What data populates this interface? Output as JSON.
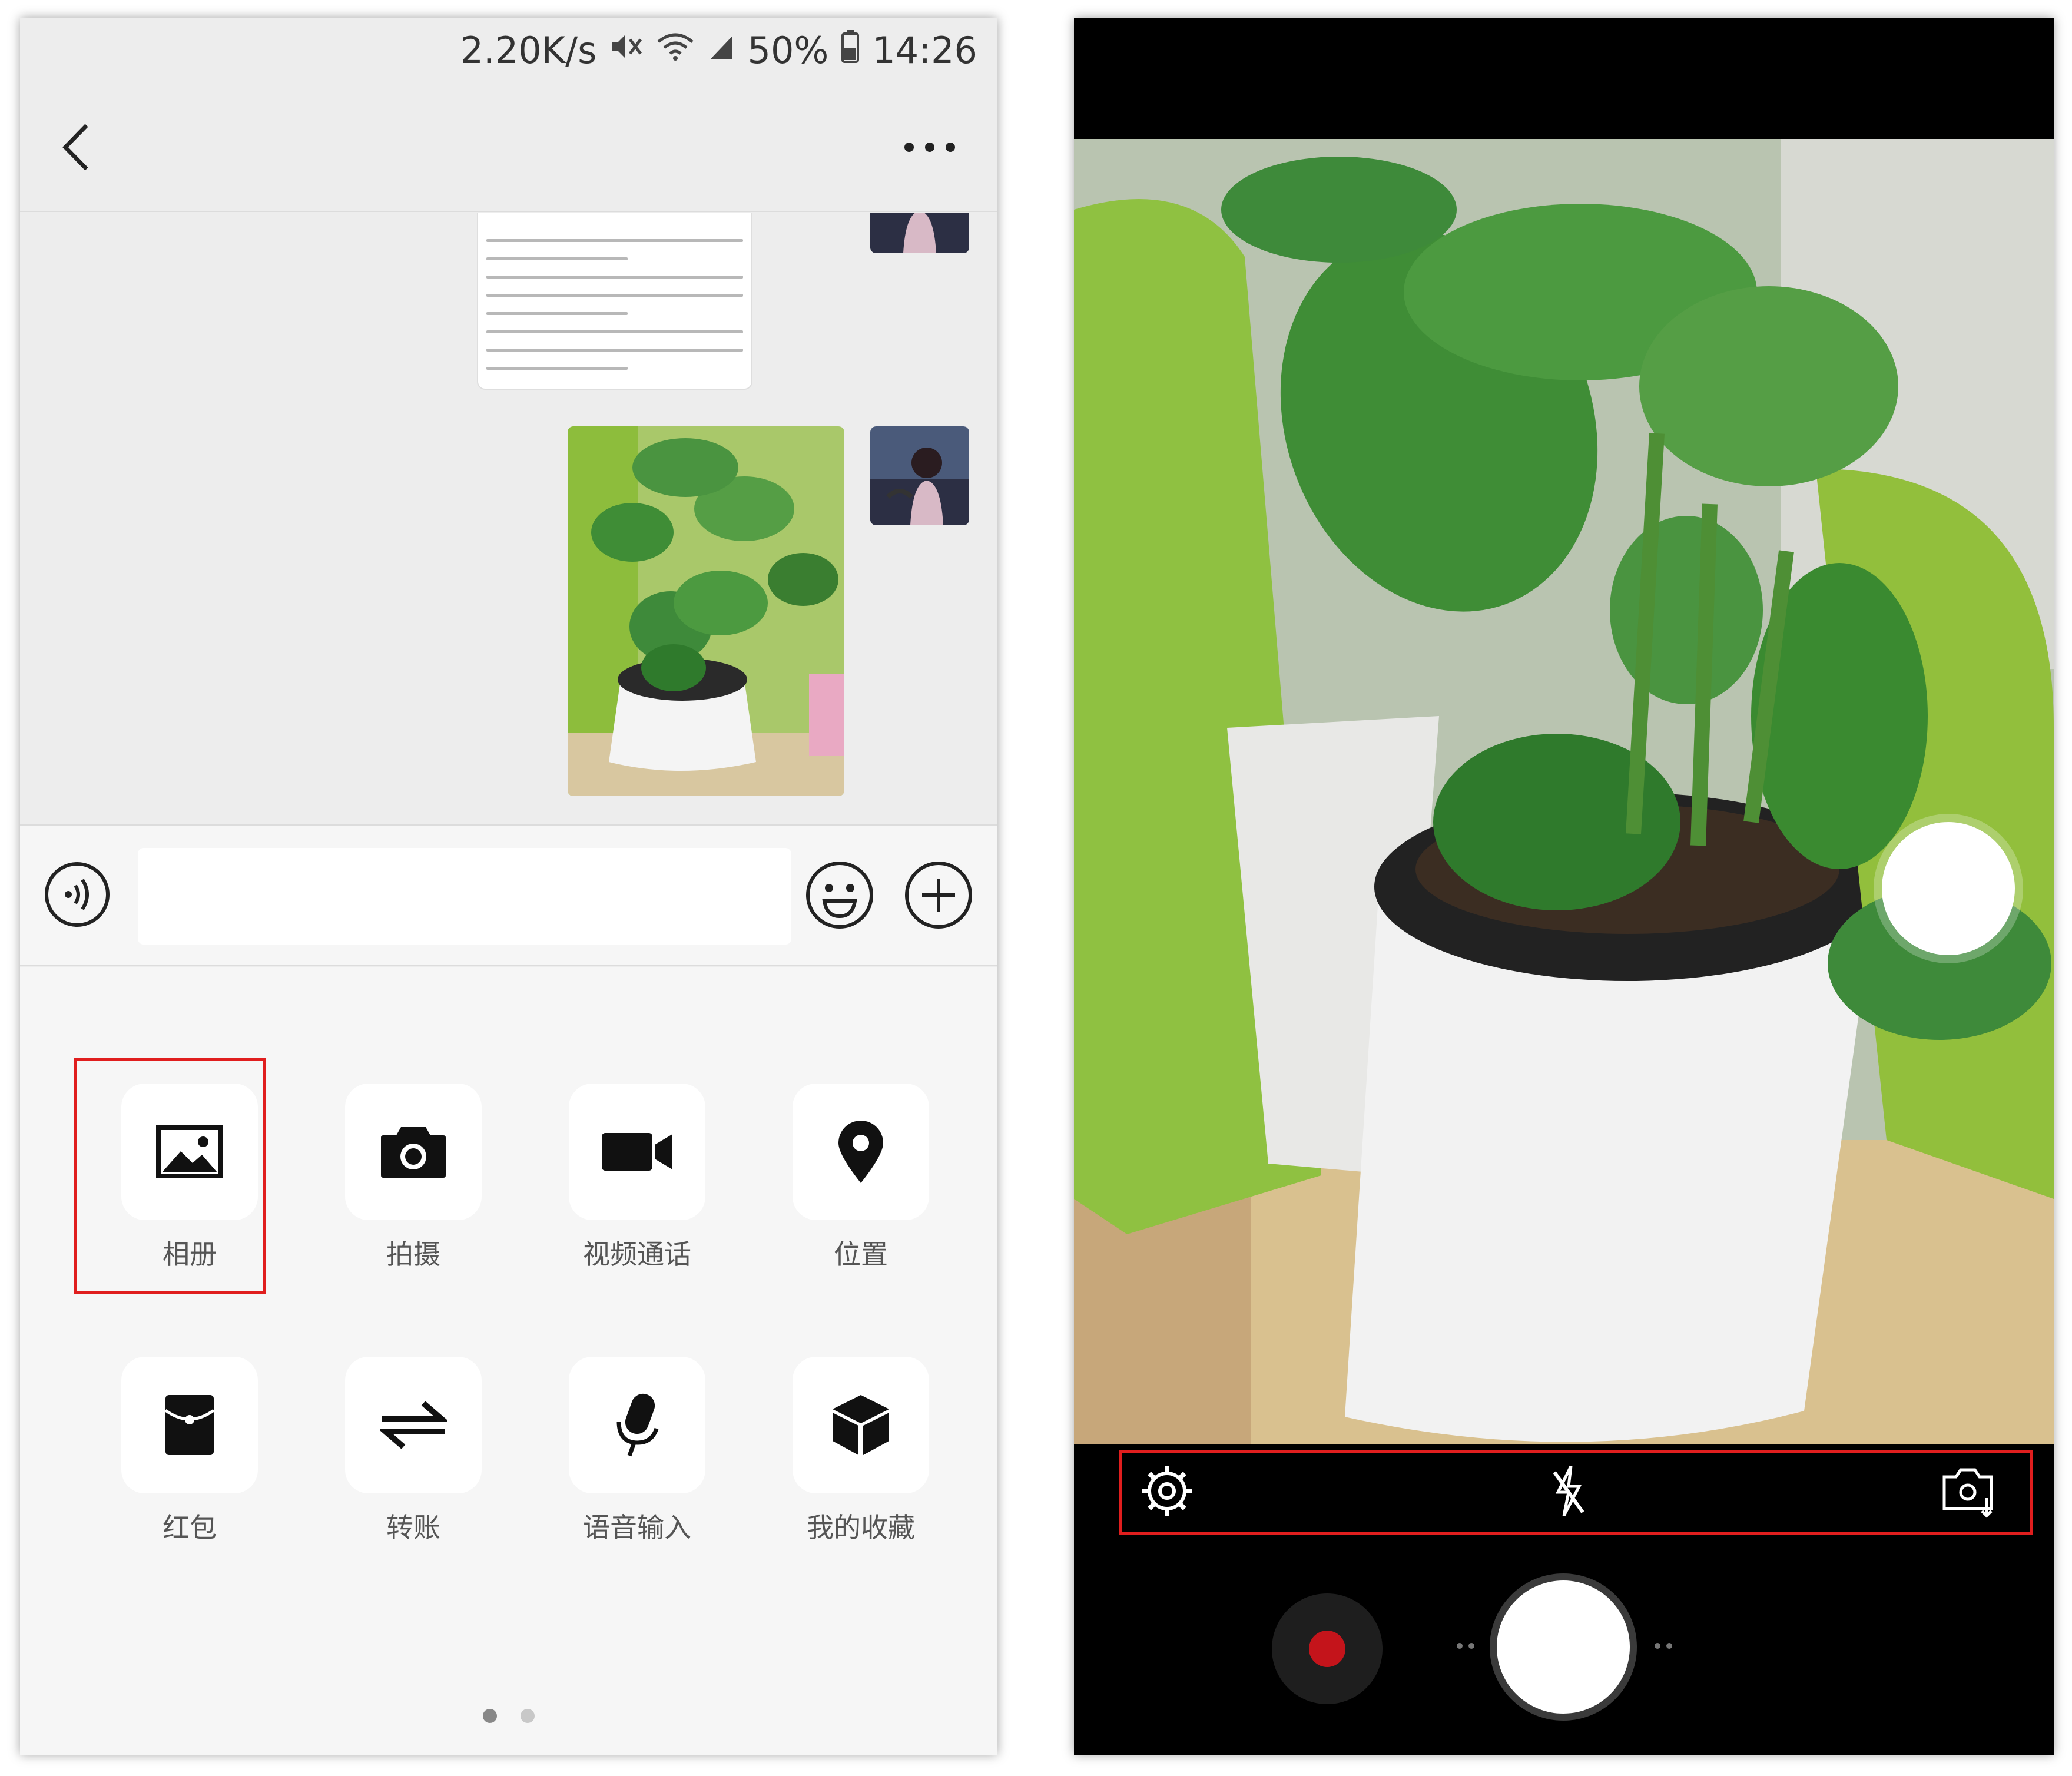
{
  "status_bar": {
    "speed": "2.20K/s",
    "battery": "50%",
    "time": "14:26",
    "icons": [
      "mute-icon",
      "wifi-icon",
      "signal-icon",
      "battery-icon"
    ]
  },
  "chat": {
    "title": "",
    "input_placeholder": "",
    "messages": [
      {
        "type": "document",
        "sender": "self"
      },
      {
        "type": "image",
        "sender": "self",
        "subject": "plant-in-white-pot"
      }
    ]
  },
  "tools": [
    {
      "label": "相册",
      "icon": "album-icon",
      "highlighted": true
    },
    {
      "label": "拍摄",
      "icon": "camera-icon",
      "highlighted": false
    },
    {
      "label": "视频通话",
      "icon": "video-call-icon",
      "highlighted": false
    },
    {
      "label": "位置",
      "icon": "location-icon",
      "highlighted": false
    },
    {
      "label": "红包",
      "icon": "red-packet-icon",
      "highlighted": false
    },
    {
      "label": "转账",
      "icon": "transfer-icon",
      "highlighted": false
    },
    {
      "label": "语音输入",
      "icon": "voice-input-icon",
      "highlighted": false
    },
    {
      "label": "我的收藏",
      "icon": "favorites-icon",
      "highlighted": false
    }
  ],
  "pager": {
    "pages": 2,
    "active": 1
  },
  "camera": {
    "controls": [
      "settings-icon",
      "flash-off-icon",
      "switch-camera-icon"
    ],
    "modes": [
      "record",
      "shutter"
    ],
    "colors": {
      "highlight": "#e01e1e",
      "record": "#c4141b"
    }
  }
}
